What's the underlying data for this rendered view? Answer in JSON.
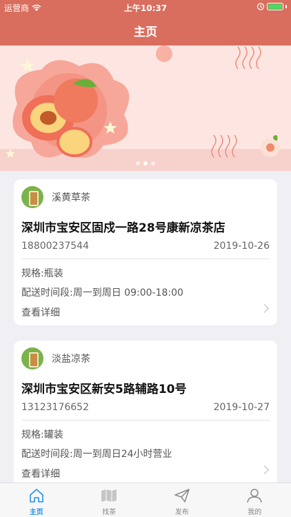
{
  "status_bar": {
    "carrier": "运营商",
    "time": "上午10:37",
    "battery_percent": 100
  },
  "nav": {
    "title": "主页"
  },
  "banner": {
    "page_count": 3,
    "active_page": 1
  },
  "colors": {
    "brand": "#d96e5e",
    "tab_active": "#1e8ff0",
    "tab_inactive": "#888888"
  },
  "cards": [
    {
      "name": "溪黄草茶",
      "address": "深圳市宝安区固戍一路28号康新凉茶店",
      "phone": "18800237544",
      "date": "2019-10-26",
      "spec": "规格:瓶装",
      "delivery": "配送时间段:周一到周日 09:00-18:00",
      "detail_label": "查看详细"
    },
    {
      "name": "淡盐凉茶",
      "address": "深圳市宝安区新安5路辅路10号",
      "phone": "13123176652",
      "date": "2019-10-27",
      "spec": "规格:罐装",
      "delivery": "配送时间段:周一到周日24小时营业",
      "detail_label": "查看详细"
    }
  ],
  "tabs": [
    {
      "label": "主页",
      "icon": "home-icon",
      "active": true
    },
    {
      "label": "找茶",
      "icon": "map-icon",
      "active": false
    },
    {
      "label": "发布",
      "icon": "send-icon",
      "active": false
    },
    {
      "label": "我的",
      "icon": "user-icon",
      "active": false
    }
  ]
}
